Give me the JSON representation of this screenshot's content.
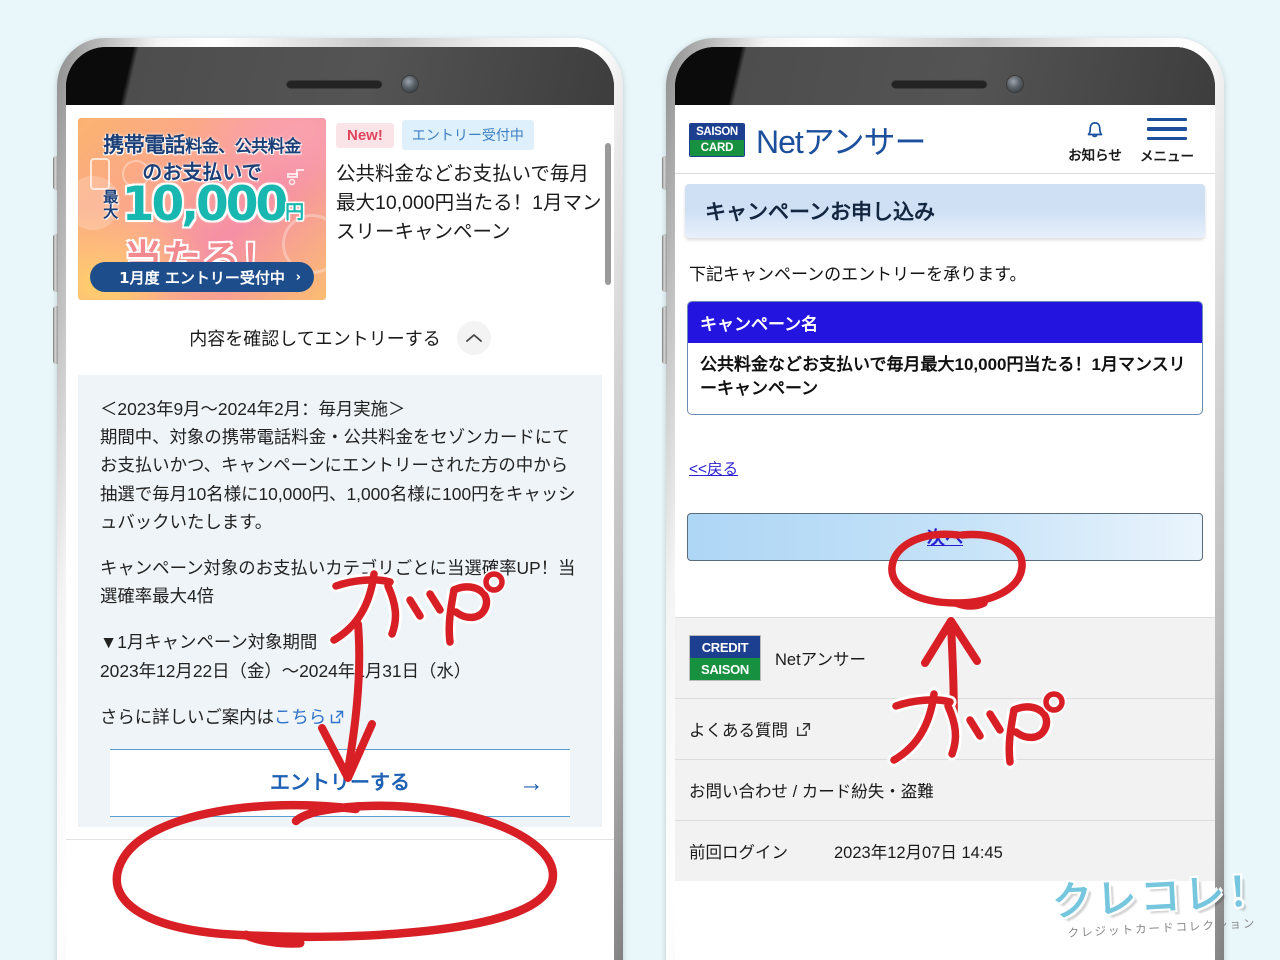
{
  "page": {
    "background_color": "#e9f7fa",
    "annotation_color": "#d81f26"
  },
  "left_phone": {
    "banner": {
      "line1_a": "携帯電話",
      "line1_b": "料金、公共料金",
      "line2": "のお支払いで",
      "saidai": "最大",
      "amount": "10,000",
      "yen": "円",
      "ataru": "当たる！",
      "pill": "1月度 エントリー受付中",
      "pill_arrow": "›"
    },
    "badges": {
      "new": "New!",
      "entry": "エントリー受付中"
    },
    "title": "公共料金などお支払いで毎月最大10,000円当たる！1月マンスリーキャンペーン",
    "accordion_label": "内容を確認してエントリーする",
    "body_paragraphs": [
      "＜2023年9月〜2024年2月：毎月実施＞\n期間中、対象の携帯電話料金・公共料金をセゾンカードにてお支払いかつ、キャンペーンにエントリーされた方の中から抽選で毎月10名様に10,000円、1,000名様に100円をキャッシュバックいたします。",
      "キャンペーン対象のお支払いカテゴリごとに当選確率UP！当選確率最大4倍",
      "▼1月キャンペーン対象期間\n2023年12月22日（金）〜2024年1月31日（水）"
    ],
    "body_last_prefix": "さらに詳しいご案内は",
    "body_last_link": "こちら",
    "entry_button": "エントリーする",
    "entry_arrow": "→"
  },
  "right_phone": {
    "header": {
      "logo_top": "SAISON",
      "logo_bottom": "CARD",
      "brand": "Netアンサー",
      "notice_label": "お知らせ",
      "menu_label": "メニュー"
    },
    "page_title": "キャンペーンお申し込み",
    "lead": "下記キャンペーンのエントリーを承ります。",
    "campaign_table": {
      "header": "キャンペーン名",
      "value": "公共料金などお支払いで毎月最大10,000円当たる！1月マンスリーキャンペーン"
    },
    "back_link": "<<戻る",
    "next_button": "次へ",
    "footer": {
      "logo_top": "CREDIT",
      "logo_bottom": "SAISON",
      "brand_text": "Netアンサー",
      "faq": "よくある質問",
      "contact": "お問い合わせ / カード紛失・盗難",
      "last_login_label": "前回ログイン",
      "last_login_value": "2023年12月07日 14:45"
    }
  },
  "annotations": {
    "tap_left": "タップ",
    "tap_right": "タップ"
  },
  "watermark": {
    "main": "クレコレ！",
    "sub": "クレジットカードコレクション"
  }
}
